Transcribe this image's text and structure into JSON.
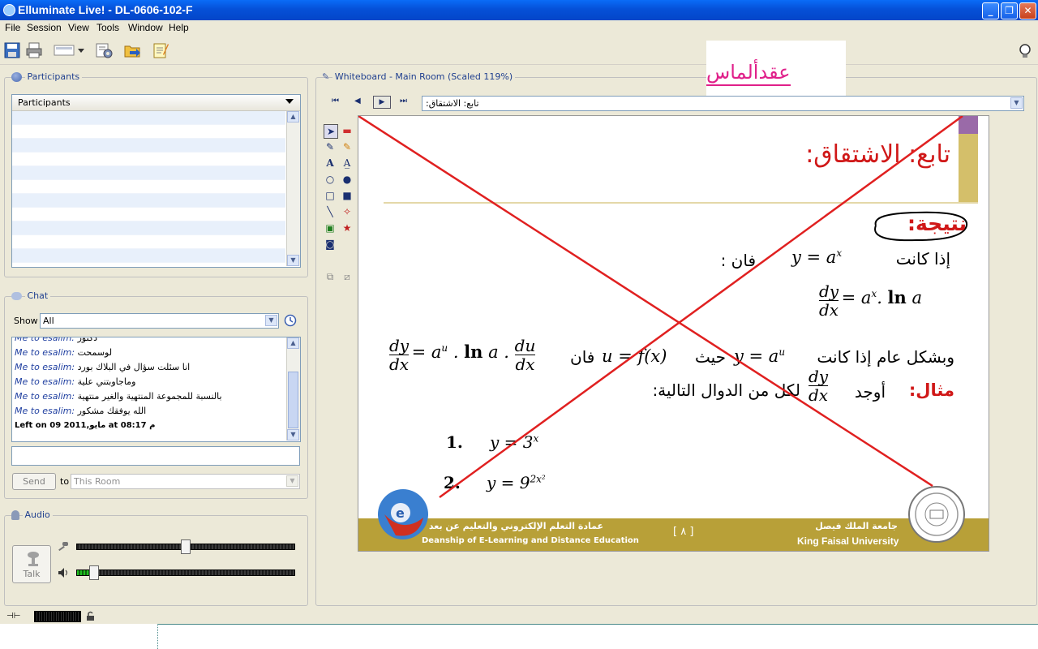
{
  "window": {
    "title": "Elluminate Live! - DL-0606-102-F"
  },
  "menu": [
    "File",
    "Session",
    "View",
    "Tools",
    "Window",
    "Help"
  ],
  "participants": {
    "panel_title": "Participants",
    "list_header": "Participants"
  },
  "chat": {
    "panel_title": "Chat",
    "show_label": "Show",
    "show_value": "All",
    "messages": [
      {
        "sender": "Me to esalim:",
        "text": "دكتور"
      },
      {
        "sender": "Me to esalim:",
        "text": "لوسمحت"
      },
      {
        "sender": "Me to esalim:",
        "text": "انا سئلت سؤال في البلاك بورد"
      },
      {
        "sender": "Me to esalim:",
        "text": "وماجاوبتني علية"
      },
      {
        "sender": "Me to esalim:",
        "text": "بالنسبة للمجموعة المنتهية والغير منتهية"
      },
      {
        "sender": "Me to esalim:",
        "text": "الله يوفقك مشكور"
      }
    ],
    "left_notice": "Left on 09 مايو,2011  at 08:17 م",
    "send_label": "Send",
    "to_label": "to",
    "to_value": "This Room"
  },
  "audio": {
    "panel_title": "Audio",
    "talk_label": "Talk",
    "mic_level": 0.5,
    "speaker_level": 0.08
  },
  "whiteboard": {
    "panel_title": "Whiteboard - Main Room (Scaled 119%)",
    "page_select": "تابع: الاشتقاق:",
    "overlay_text": "عقدألماس",
    "slide": {
      "title": "تابع: الاشتقاق:",
      "result_label": "نتيجة:",
      "if_text": "إذا كانت",
      "then_text": "فان :",
      "eq1": "y = a",
      "eq1_sup": "x",
      "general_text": "وبشكل عام إذا كانت",
      "where_text": "حيث",
      "then2_text": "فان",
      "example_label": "مثال:",
      "find_text": "أوجد",
      "for_each_text": "لكل من الدوال التالية:",
      "item1_num": "1.",
      "item1": "y = 3",
      "item1_sup": "x",
      "item2_num": "2.",
      "item2": "y = 9",
      "item2_sup": "2x²",
      "footer_ar_left": "عمادة التعلم الإلكتروني والتعليم عن بعد",
      "footer_en_left": "Deanship of E-Learning and Distance Education",
      "footer_page": "[ ٨ ]",
      "footer_ar_right": "جامعة الملك فيصل",
      "footer_en_right": "King Faisal University"
    }
  },
  "colors": {
    "titlebar": "#0550d8",
    "slide_title": "#d01818",
    "footer": "#b8a038",
    "cross": "#e02020",
    "overlay": "#e0208a"
  }
}
